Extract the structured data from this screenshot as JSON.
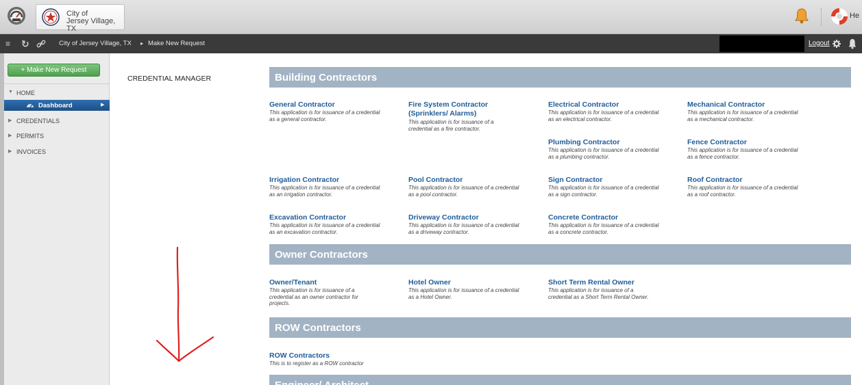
{
  "header": {
    "city_line1": "City of",
    "city_line2": "Jersey Village, TX",
    "help_label": "He"
  },
  "toolbar": {
    "breadcrumb_city": "City of Jersey Village, TX",
    "breadcrumb_separator": "▸",
    "breadcrumb_page": "Make New Request",
    "logout_label": "Logout"
  },
  "sidebar": {
    "make_request_label": "+ Make New Request",
    "home_label": "HOME",
    "dashboard_label": "Dashboard",
    "items": [
      {
        "label": "CREDENTIALS"
      },
      {
        "label": "PERMITS"
      },
      {
        "label": "INVOICES"
      }
    ]
  },
  "main": {
    "credential_manager_label": "CREDENTIAL MANAGER",
    "sections": [
      {
        "title": "Building Contractors",
        "items": [
          {
            "title": "General Contractor",
            "desc": "This application is for issuance of a credential as a general contractor."
          },
          {
            "title": "Fire System Contractor (Sprinklers/ Alarms)",
            "desc": "This application is for issuance of a credential as a fire contractor."
          },
          {
            "title": "Electrical Contractor",
            "desc": "This application is for issuance of a credential as an electrical contractor."
          },
          {
            "title": "Mechanical Contractor",
            "desc": "This application is for issuance of a credential as a mechanical contractor."
          },
          {
            "title": "Plumbing Contractor",
            "desc": "This application is for issuance of a credential as a plumbing contractor."
          },
          {
            "title": "Fence Contractor",
            "desc": "This application is for issuance of a credential as a fence contractor."
          },
          {
            "title": "Irrigation Contractor",
            "desc": "This application is for issuance of a credential as an irrigation contractor."
          },
          {
            "title": "Pool Contractor",
            "desc": "This application is for issuance of a credential as a pool contractor."
          },
          {
            "title": "Sign Contractor",
            "desc": "This application is for issuance of a credential as a sign contractor."
          },
          {
            "title": "Roof Contractor",
            "desc": "This application is for issuance of a credential as a roof contractor."
          },
          {
            "title": "Excavation Contractor",
            "desc": "This application is for issuance of a credential as an excavation contractor."
          },
          {
            "title": "Driveway Contractor",
            "desc": "This application is for issuance of a credential as a driveway contractor."
          },
          {
            "title": "Concrete Contractor",
            "desc": "This application is for issuance of a credential as a concrete contractor."
          }
        ]
      },
      {
        "title": "Owner Contractors",
        "items": [
          {
            "title": "Owner/Tenant",
            "desc": "This application is for issuance of a credential as an owner contractor for projects."
          },
          {
            "title": "Hotel Owner",
            "desc": "This application is for issuance of a credential as a Hotel Owner."
          },
          {
            "title": "Short Term Rental Owner",
            "desc": "This application is for issuance of a credential as a Short Term Rental Owner."
          }
        ]
      },
      {
        "title": "ROW Contractors",
        "items": [
          {
            "title": "ROW Contractors",
            "desc": "This is to register as a ROW contractor"
          }
        ]
      },
      {
        "title": "Engineer/ Architect",
        "items": []
      }
    ]
  },
  "colors": {
    "section_header": "#a2b3c4",
    "link_blue": "#1f5c99",
    "nav_active": "#1d4f85",
    "primary_button": "#4fa04f",
    "annotation_arrow": "#e02020"
  },
  "icons": {
    "app_logo": "dashboard-gauge-icon",
    "city_seal": "star-seal-icon",
    "notifications": "bell-icon",
    "help": "lifebuoy-icon",
    "toolbar_menu": "hamburger-icon",
    "toolbar_refresh": "refresh-icon",
    "toolbar_link": "link-icon",
    "toolbar_settings": "gear-icon"
  }
}
